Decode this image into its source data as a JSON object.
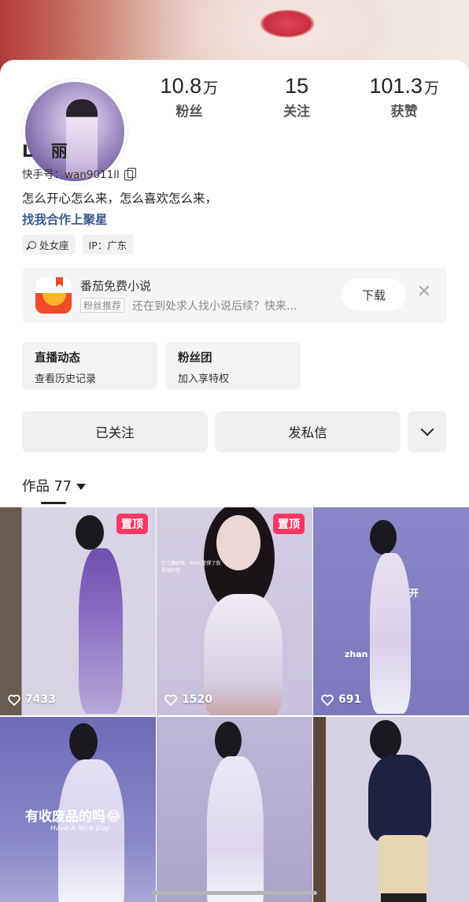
{
  "profile": {
    "name": "L  丽",
    "kuaishou_id": "快手号：wan9011ll",
    "bio": "怎么开心怎么来，怎么喜欢怎么来，",
    "bio_link": "找我合作上聚星",
    "stats": [
      {
        "num": "10.8",
        "unit": "万",
        "label": "粉丝"
      },
      {
        "num": "15",
        "unit": "",
        "label": "关注"
      },
      {
        "num": "101.3",
        "unit": "万",
        "label": "获赞"
      }
    ],
    "tags": [
      "处女座",
      "IP：广东"
    ]
  },
  "ad": {
    "app_name": "番茄免费小说",
    "badge": "粉丝推荐",
    "desc": "还在到处求人找小说后续？快来...",
    "download_label": "下载",
    "close_symbol": "✕"
  },
  "entries": [
    {
      "title": "直播动态",
      "sub": "查看历史记录"
    },
    {
      "title": "粉丝团",
      "sub": "加入享特权"
    }
  ],
  "actions": {
    "follow_label": "已关注",
    "message_label": "发私信"
  },
  "works": {
    "tab_label": "作品 77",
    "items": [
      {
        "likes": "7433",
        "pinned": "置顶",
        "caption": ""
      },
      {
        "likes": "1520",
        "pinned": "置顶",
        "caption": "打工赚好钱，60% 觉得了我是保护我"
      },
      {
        "likes": "691",
        "pinned": "",
        "caption": "开"
      },
      {
        "likes": "",
        "pinned": "",
        "caption": "有收废品的吗😂"
      },
      {
        "likes": "",
        "pinned": "",
        "caption": ""
      },
      {
        "likes": "",
        "pinned": "",
        "caption": ""
      }
    ],
    "extra_captions": {
      "t3_small": "zhan",
      "t4_sub": "Have A Nice Day"
    }
  },
  "colors": {
    "pin_bg": "#fe3666",
    "link": "#3a5a8c"
  }
}
